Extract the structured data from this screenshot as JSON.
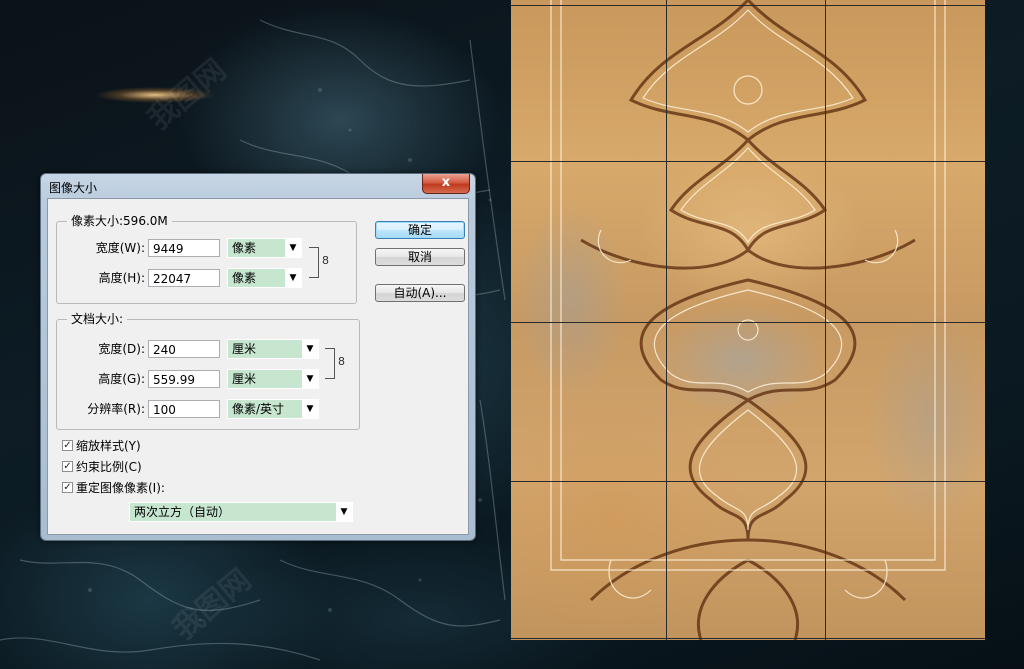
{
  "background": {
    "watermark": "我图网",
    "colors": {
      "ocean": "#0d1c25",
      "marble": "#d2a56d",
      "line": "#2a2a2a"
    }
  },
  "dialog": {
    "title": "图像大小",
    "close_icon": "close-x-icon",
    "close_glyph": "x",
    "pixel_dimensions": {
      "heading": "像素大小:596.0M",
      "width_label": "宽度(W):",
      "width_value": "9449",
      "width_unit": "像素",
      "height_label": "高度(H):",
      "height_value": "22047",
      "height_unit": "像素"
    },
    "document_size": {
      "heading": "文档大小:",
      "width_label": "宽度(D):",
      "width_value": "240",
      "width_unit": "厘米",
      "height_label": "高度(G):",
      "height_value": "559.99",
      "height_unit": "厘米",
      "resolution_label": "分辨率(R):",
      "resolution_value": "100",
      "resolution_unit": "像素/英寸"
    },
    "buttons": {
      "ok": "确定",
      "cancel": "取消",
      "auto": "自动(A)..."
    },
    "options": {
      "scale_styles": {
        "label": "缩放样式(Y)",
        "checked": true
      },
      "constrain": {
        "label": "约束比例(C)",
        "checked": true
      },
      "resample": {
        "label": "重定图像像素(I):",
        "checked": true
      },
      "resample_method": "两次立方（自动）"
    },
    "check_glyph": "✓",
    "arrow_glyph": "▼",
    "link_glyph": "8"
  }
}
